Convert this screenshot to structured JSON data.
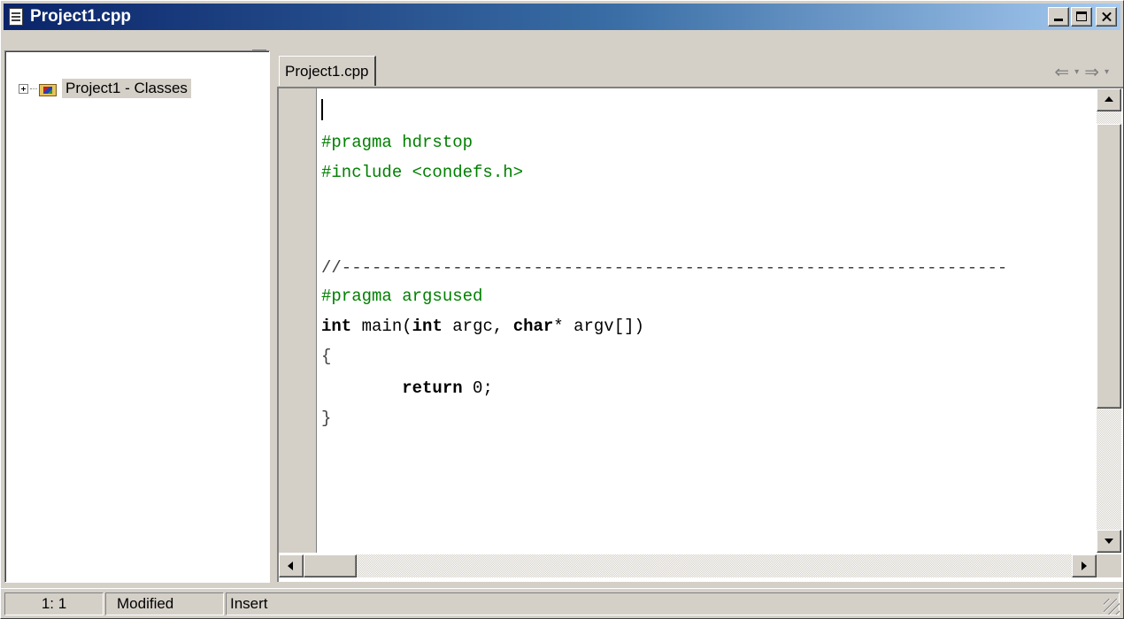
{
  "window": {
    "title": "Project1.cpp"
  },
  "class_explorer": {
    "root_label": "Project1 - Classes"
  },
  "editor": {
    "tab_label": "Project1.cpp",
    "nav_back": "⇐",
    "nav_forward": "⇒",
    "nav_dropdown": "▾",
    "code_lines": [
      {
        "text": "#pragma hdrstop"
      },
      {
        "text": "#include <condefs.h>"
      },
      {
        "text": "//------------------------------------------------------------------"
      },
      {
        "text": "#pragma argsused"
      },
      {
        "kw_int": "int",
        "mid1": " main(",
        "kw_int2": "int",
        "mid2": " argc, ",
        "kw_char": "char",
        "end": "* argv[])"
      },
      {
        "text": "{"
      },
      {
        "indent": "        ",
        "kw_return": "return",
        "end": " 0;"
      },
      {
        "text": "}"
      }
    ]
  },
  "statusbar": {
    "position": "1:  1",
    "modified": "Modified",
    "mode": "Insert"
  },
  "colors": {
    "title_gradient_start": "#0a246a",
    "title_gradient_end": "#a6caf0",
    "directive_green": "#008000",
    "chrome": "#d4d0c8"
  }
}
